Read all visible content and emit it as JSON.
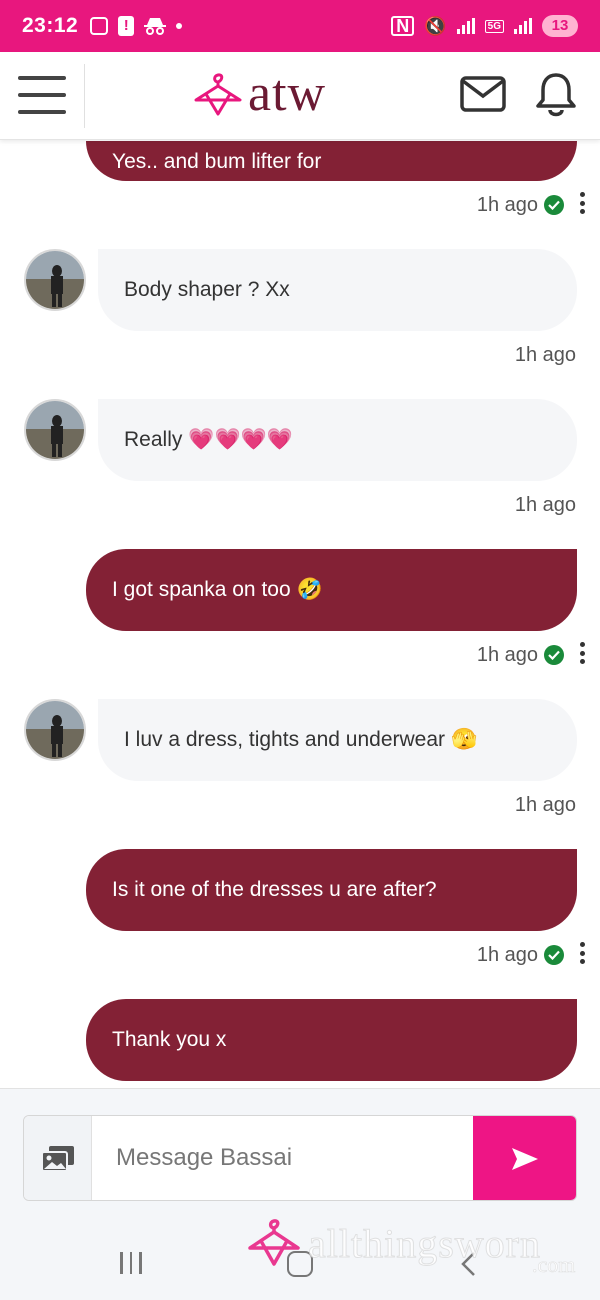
{
  "status_bar": {
    "time": "23:12",
    "network": "5G",
    "battery": "13"
  },
  "header": {
    "logo_text": "atw",
    "brand_color": "#6b1a33",
    "accent_color": "#e8177e"
  },
  "messages": [
    {
      "direction": "out",
      "text": "Yes.. and bum lifter for",
      "time": "1h ago",
      "read": true
    },
    {
      "direction": "in",
      "text": "Body shaper ? Xx",
      "time": "1h ago"
    },
    {
      "direction": "in",
      "text": "Really",
      "emoji": "💗💗💗💗",
      "time": "1h ago"
    },
    {
      "direction": "out",
      "text": "I got spanka on too",
      "emoji": "🤣",
      "time": "1h ago",
      "read": true
    },
    {
      "direction": "in",
      "text": "I luv a dress, tights and underwear",
      "emoji": "🫣",
      "time": "1h ago"
    },
    {
      "direction": "out",
      "text": "Is it one of the dresses u are after?",
      "time": "1h ago",
      "read": true
    },
    {
      "direction": "out",
      "text": "Thank you x"
    }
  ],
  "composer": {
    "placeholder": "Message Bassai"
  },
  "watermark": {
    "text": "allthingsworn",
    "suffix": ".com"
  }
}
